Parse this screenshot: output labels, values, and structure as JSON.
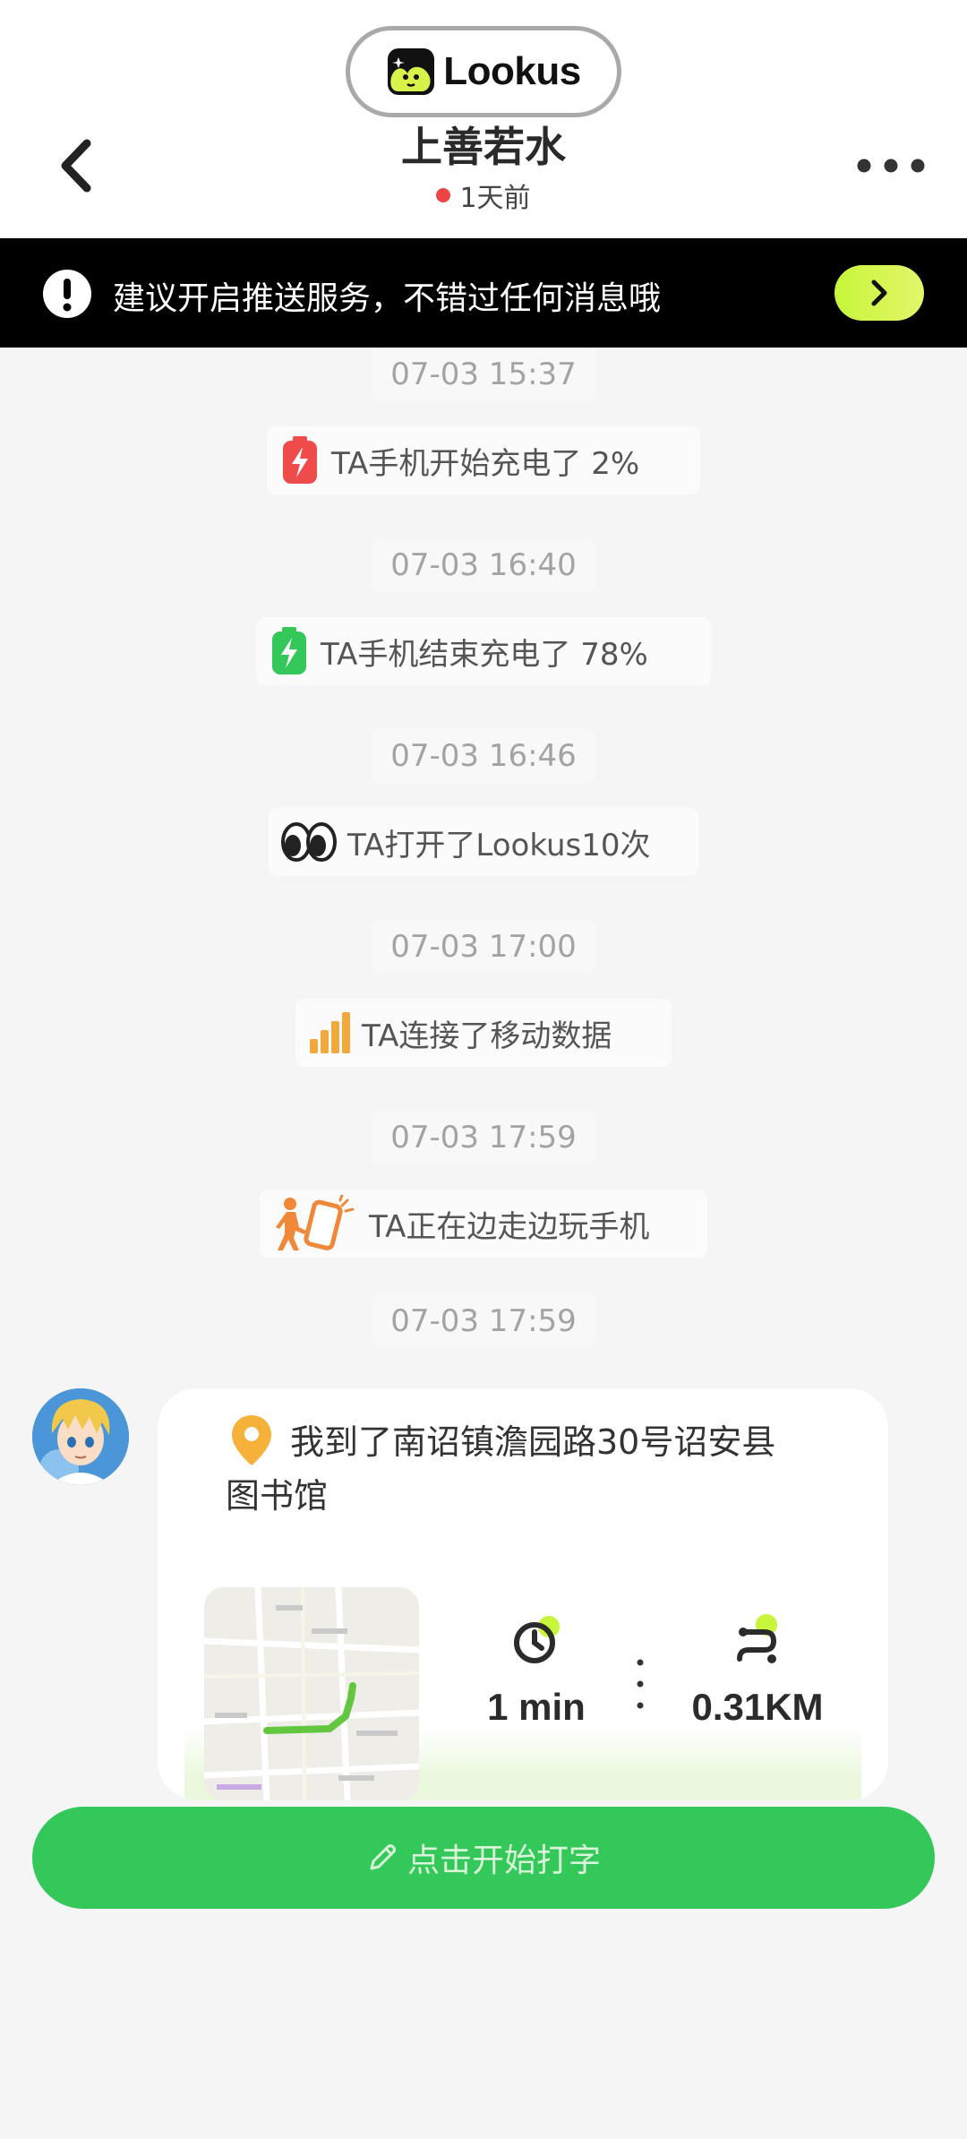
{
  "app": {
    "name": "Lookus"
  },
  "header": {
    "title": "上善若水",
    "status": "1天前"
  },
  "banner": {
    "text": "建议开启推送服务，不错过任何消息哦"
  },
  "feed": [
    {
      "time": "07-03 15:37",
      "text": "TA手机开始充电了 2%",
      "icon": "battery-charging-red-icon"
    },
    {
      "time": "07-03 16:40",
      "text": "TA手机结束充电了 78%",
      "icon": "battery-charging-green-icon"
    },
    {
      "time": "07-03 16:46",
      "text": "TA打开了Lookus10次",
      "icon": "eyes-icon"
    },
    {
      "time": "07-03 17:00",
      "text": "TA连接了移动数据",
      "icon": "signal-bars-icon"
    },
    {
      "time": "07-03 17:59",
      "text": "TA正在边走边玩手机",
      "icon": "walking-phone-icon"
    }
  ],
  "location": {
    "time": "07-03 17:59",
    "text": "我到了南诏镇澹园路30号诏安县图书馆",
    "duration": "1 min",
    "distance": "0.31KM"
  },
  "input": {
    "label": "点击开始打字"
  },
  "colors": {
    "accent_green": "#34c759",
    "banner_bg": "#000000",
    "lime": "#c6f53a",
    "status_red": "#ee4444"
  }
}
